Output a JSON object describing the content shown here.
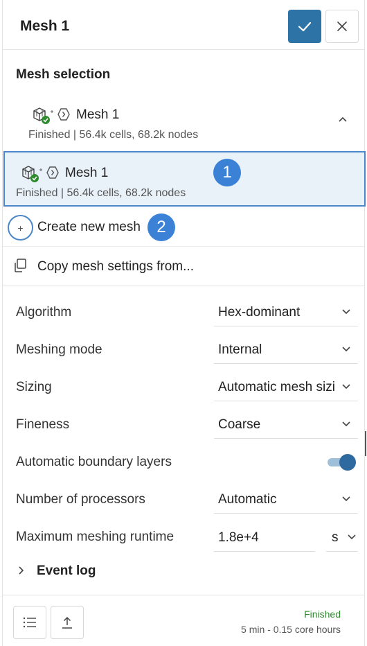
{
  "header": {
    "title": "Mesh 1"
  },
  "icons": {
    "confirm": "check-icon",
    "close": "close-icon",
    "mesh": "mesh-cube-status-icon",
    "link": "chevron-link-icon",
    "chevron_up": "chevron-up-icon",
    "chevron_down": "chevron-down-icon",
    "plus": "plus-icon",
    "copy": "copy-icon",
    "list": "list-icon",
    "upload": "upload-icon",
    "expand": "chevron-right-icon"
  },
  "colors": {
    "accent": "#2e73a6",
    "selection_border": "#4a86c8",
    "selection_bg": "#e9f1f9",
    "badge": "#3b82d6",
    "success": "#2e8b2e"
  },
  "mesh_selection": {
    "title": "Mesh selection",
    "parent": {
      "name": "Mesh 1",
      "status": "Finished | 56.4k cells, 68.2k nodes"
    },
    "selected": {
      "name": "Mesh 1",
      "status": "Finished | 56.4k cells, 68.2k nodes",
      "badge": "1"
    },
    "create_label": "Create new mesh",
    "create_badge": "2",
    "copy_label": "Copy mesh settings from..."
  },
  "properties": {
    "algorithm": {
      "label": "Algorithm",
      "value": "Hex-dominant"
    },
    "meshing_mode": {
      "label": "Meshing mode",
      "value": "Internal"
    },
    "sizing": {
      "label": "Sizing",
      "value": "Automatic mesh sizi"
    },
    "fineness": {
      "label": "Fineness",
      "value": "Coarse"
    },
    "boundary_layers": {
      "label": "Automatic boundary layers",
      "enabled": true
    },
    "processors": {
      "label": "Number of processors",
      "value": "Automatic"
    },
    "runtime": {
      "label": "Maximum meshing runtime",
      "value": "1.8e+4",
      "unit": "s"
    }
  },
  "event_log": {
    "label": "Event log"
  },
  "footer": {
    "status": "Finished",
    "details": "5 min - 0.15 core hours"
  }
}
